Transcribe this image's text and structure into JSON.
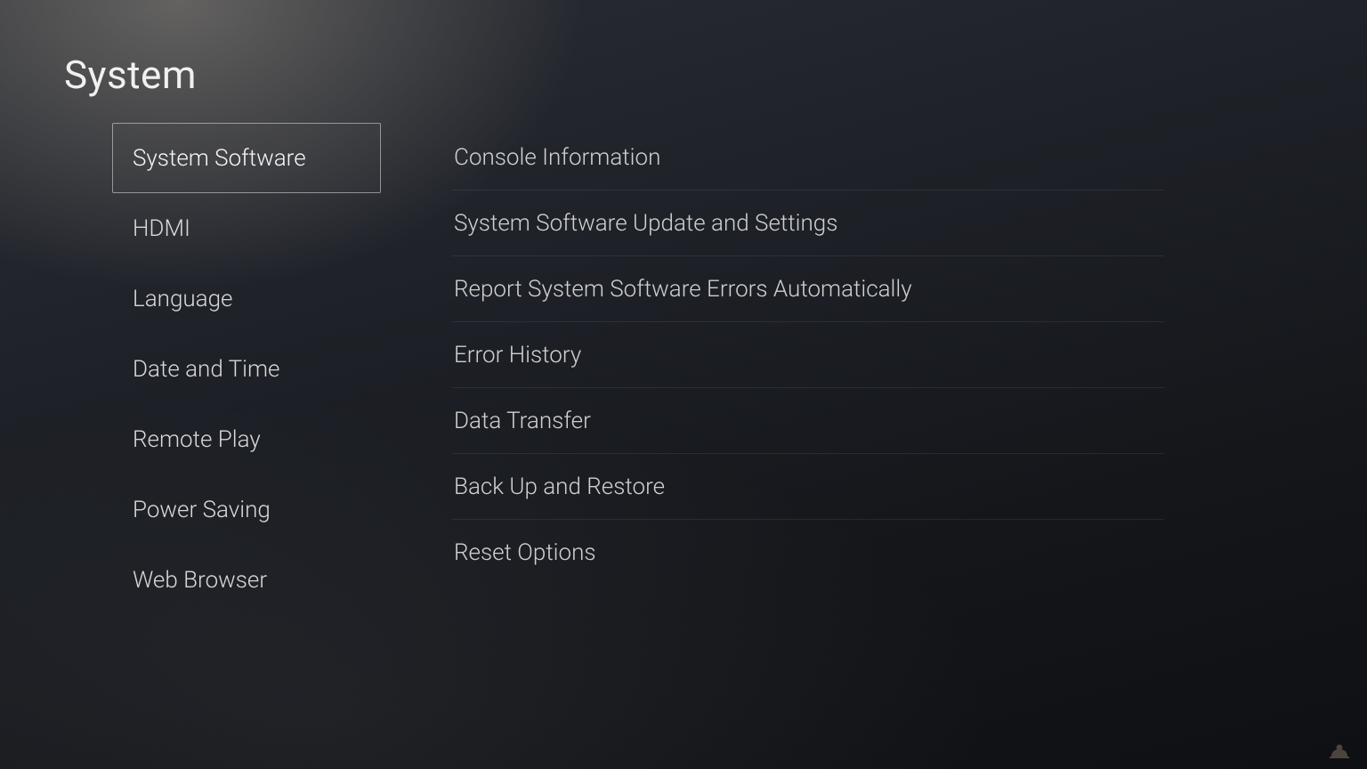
{
  "title": "System",
  "sidebar": {
    "items": [
      {
        "label": "System Software",
        "selected": true
      },
      {
        "label": "HDMI",
        "selected": false
      },
      {
        "label": "Language",
        "selected": false
      },
      {
        "label": "Date and Time",
        "selected": false
      },
      {
        "label": "Remote Play",
        "selected": false
      },
      {
        "label": "Power Saving",
        "selected": false
      },
      {
        "label": "Web Browser",
        "selected": false
      }
    ]
  },
  "content": {
    "items": [
      {
        "label": "Console Information"
      },
      {
        "label": "System Software Update and Settings"
      },
      {
        "label": "Report System Software Errors Automatically"
      },
      {
        "label": "Error History"
      },
      {
        "label": "Data Transfer"
      },
      {
        "label": "Back Up and Restore"
      },
      {
        "label": "Reset Options"
      }
    ]
  }
}
